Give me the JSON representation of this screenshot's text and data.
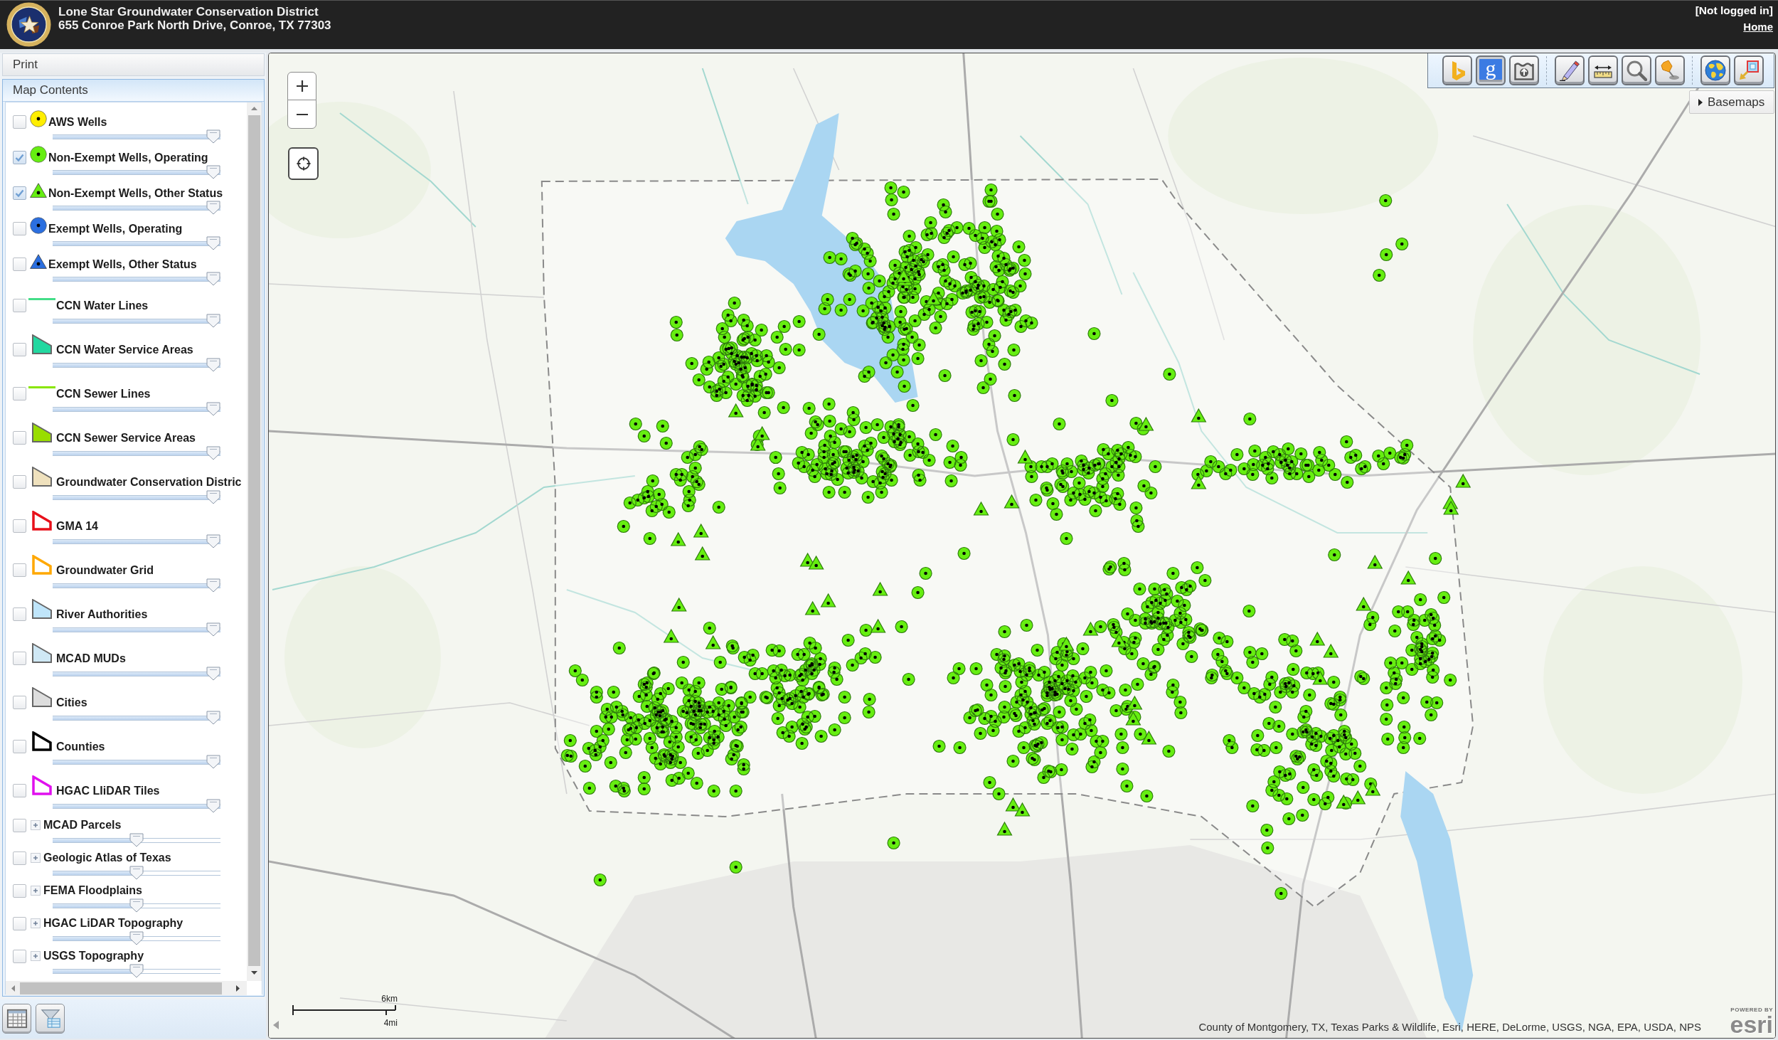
{
  "header": {
    "title": "Lone Star Groundwater Conservation District",
    "address": "655 Conroe Park North Drive, Conroe, TX 77303",
    "login_status": "[Not logged in]",
    "home_link": "Home"
  },
  "sidebar": {
    "print_panel": {
      "title": "Print"
    },
    "contents_panel": {
      "title": "Map Contents"
    },
    "layers": [
      {
        "kind": "circle",
        "label": "AWS Wells",
        "checked": false,
        "color": "#ffee00",
        "level": 1
      },
      {
        "kind": "circle",
        "label": "Non-Exempt Wells, Operating",
        "checked": true,
        "color": "#66ee11",
        "level": 1
      },
      {
        "kind": "triangle",
        "label": "Non-Exempt Wells, Other Status",
        "checked": true,
        "color": "#66ee11",
        "level": 1
      },
      {
        "kind": "circle",
        "label": "Exempt Wells, Operating",
        "checked": false,
        "color": "#2b6fe0",
        "level": 1
      },
      {
        "kind": "triangle",
        "label": "Exempt Wells, Other Status",
        "checked": false,
        "color": "#2b6fe0",
        "level": 1
      },
      {
        "kind": "line",
        "label": "CCN Water Lines",
        "checked": false,
        "color": "#44dd88",
        "level": 1
      },
      {
        "kind": "area",
        "label": "CCN Water Service Areas",
        "checked": false,
        "color": "#22d8a0",
        "level": 1
      },
      {
        "kind": "line",
        "label": "CCN Sewer Lines",
        "checked": false,
        "color": "#88e600",
        "level": 1
      },
      {
        "kind": "area",
        "label": "CCN Sewer Service Areas",
        "checked": false,
        "color": "#99dd00",
        "level": 1
      },
      {
        "kind": "area",
        "label": "Groundwater Conservation Distric",
        "checked": false,
        "color": "#efe1bd",
        "level": 1
      },
      {
        "kind": "outline",
        "label": "GMA 14",
        "checked": false,
        "color": "#e8101a",
        "level": 1
      },
      {
        "kind": "outline",
        "label": "Groundwater Grid",
        "checked": false,
        "color": "#ffa800",
        "level": 1
      },
      {
        "kind": "area",
        "label": "River Authorities",
        "checked": false,
        "color": "#bfe5fa",
        "level": 1
      },
      {
        "kind": "area",
        "label": "MCAD MUDs",
        "checked": false,
        "color": "#cfe8f5",
        "level": 1
      },
      {
        "kind": "area",
        "label": "Cities",
        "checked": false,
        "color": "#dddddd",
        "level": 1
      },
      {
        "kind": "outline",
        "label": "Counties",
        "checked": false,
        "color": "#000000",
        "level": 1
      },
      {
        "kind": "outline",
        "label": "HGAC LIiDAR Tiles",
        "checked": false,
        "color": "#e010ee",
        "level": 1
      },
      {
        "kind": "group",
        "label": "MCAD Parcels",
        "checked": false,
        "expanded": false,
        "level": 0.5
      },
      {
        "kind": "group",
        "label": "Geologic Atlas of Texas",
        "checked": false,
        "expanded": false,
        "level": 0.5
      },
      {
        "kind": "group",
        "label": "FEMA Floodplains",
        "checked": false,
        "expanded": false,
        "level": 0.5
      },
      {
        "kind": "group",
        "label": "HGAC LiDAR Topography",
        "checked": false,
        "expanded": false,
        "level": 0.5
      },
      {
        "kind": "group",
        "label": "USGS Topography",
        "checked": false,
        "expanded": false,
        "level": 0.5
      }
    ],
    "tools": [
      {
        "kind": "table"
      },
      {
        "kind": "filter"
      }
    ]
  },
  "map": {
    "toolbar": [
      [
        {
          "kind": "bing"
        },
        {
          "kind": "google",
          "label": "g"
        },
        {
          "kind": "tank"
        }
      ],
      [
        {
          "kind": "pencil"
        },
        {
          "kind": "ruler"
        },
        {
          "kind": "search"
        },
        {
          "kind": "pushpin"
        }
      ],
      [
        {
          "kind": "globe"
        },
        {
          "kind": "extent"
        }
      ]
    ],
    "basemaps_button": {
      "label": "Basemaps"
    },
    "scale_bar": {
      "metric": "6km",
      "imperial": "4mi"
    },
    "attribution": "County of Montgomery, TX, Texas Parks & Wildlife, Esri, HERE, DeLorme, USGS, NGA, EPA, USDA, NPS",
    "logo": {
      "caption": "POWERED BY",
      "wordmark": "esri"
    }
  }
}
